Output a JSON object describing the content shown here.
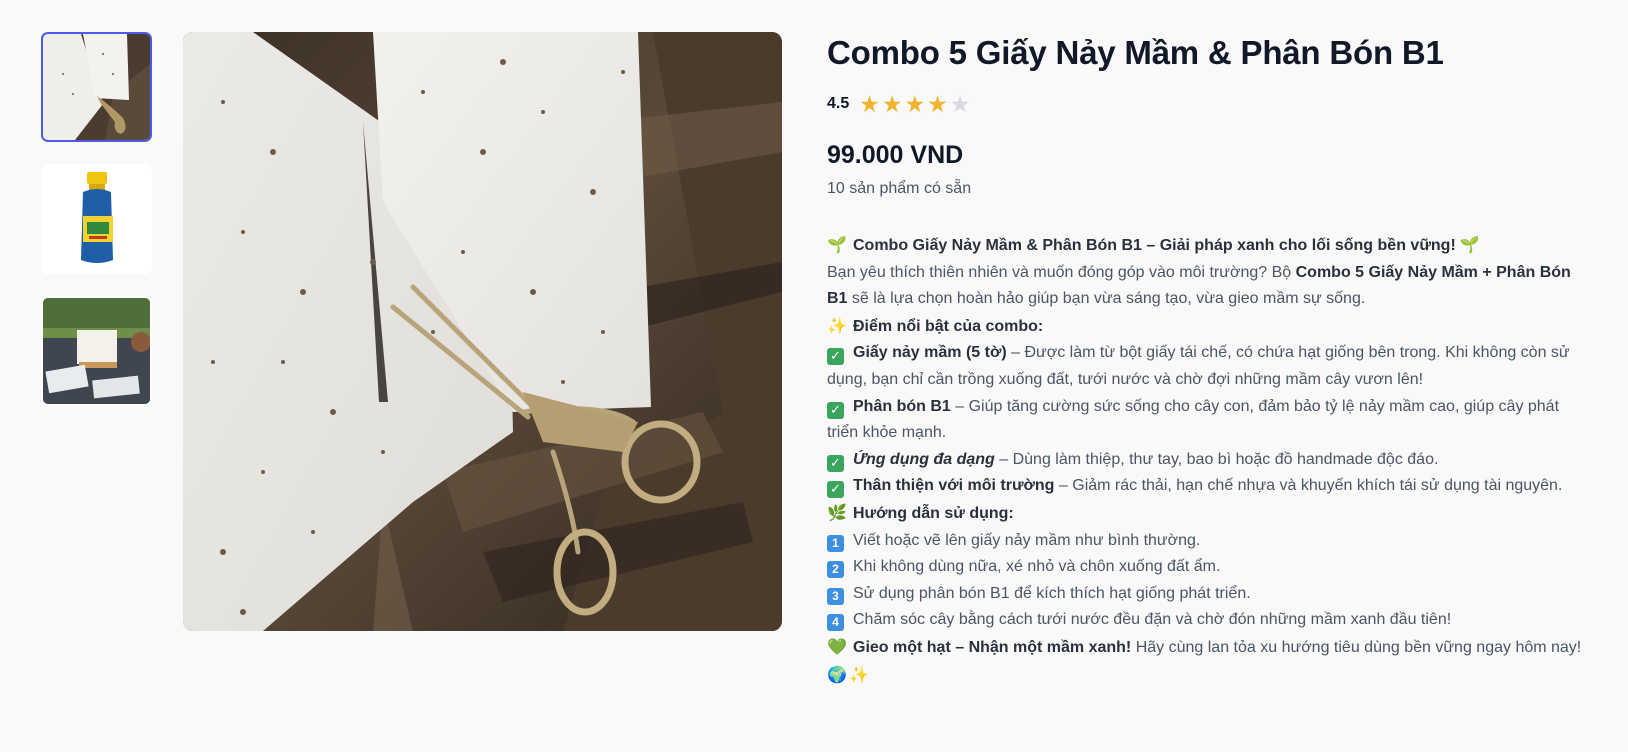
{
  "product": {
    "title": "Combo 5 Giấy Nảy Mầm & Phân Bón B1",
    "rating": {
      "value": "4.5",
      "stars": [
        "★",
        "★",
        "★",
        "★",
        "★"
      ],
      "filled": 4
    },
    "price": "99.000 VND",
    "stock": "10 sản phẩm có sẵn"
  },
  "gallery": {
    "thumbnails": [
      {
        "icon": "seed-paper-scissors-thumbnail",
        "selected": true
      },
      {
        "icon": "fertilizer-bottle-thumbnail",
        "selected": false
      },
      {
        "icon": "garden-table-cards-thumbnail",
        "selected": false
      }
    ],
    "main_image": "seed-paper-with-scissors-photo"
  },
  "description": {
    "headline_icon": "🌱",
    "headline": "Combo Giấy Nảy Mầm & Phân Bón B1 – Giải pháp xanh cho lối sống bền vững!",
    "headline_icon_end": "🌱",
    "intro_pre": "Bạn yêu thích thiên nhiên và muốn đóng góp vào môi trường? Bộ ",
    "intro_bold": "Combo 5 Giấy Nảy Mầm + Phân Bón B1",
    "intro_post": " sẽ là lựa chọn hoàn hảo giúp bạn vừa sáng tạo, vừa gieo mầm sự sống.",
    "features_icon": "✨",
    "features_heading": "Điểm nổi bật của combo:",
    "check_glyph": "✓",
    "f1_bold": "Giấy nảy mầm (5 tờ)",
    "f1_text": " – Được làm từ bột giấy tái chế, có chứa hạt giống bên trong. Khi không còn sử dụng, bạn chỉ cần trồng xuống đất, tưới nước và chờ đợi những mầm cây vươn lên!",
    "f2_bold": "Phân bón B1",
    "f2_text": " – Giúp tăng cường sức sống cho cây con, đảm bảo tỷ lệ nảy mầm cao, giúp cây phát triển khỏe mạnh.",
    "f3_bold": "Ứng dụng đa dạng",
    "f3_text": " – Dùng làm thiệp, thư tay, bao bì hoặc đồ handmade độc đáo.",
    "f4_bold": "Thân thiện với môi trường",
    "f4_text": " – Giảm rác thải, hạn chế nhựa và khuyến khích tái sử dụng tài nguyên.",
    "guide_icon": "🌿",
    "guide_heading": "Hướng dẫn sử dụng:",
    "s1_num": "1",
    "s1": "Viết hoặc vẽ lên giấy nảy mầm như bình thường.",
    "s2_num": "2",
    "s2": "Khi không dùng nữa, xé nhỏ và chôn xuống đất ẩm.",
    "s3_num": "3",
    "s3": "Sử dụng phân bón B1 để kích thích hạt giống phát triển.",
    "s4_num": "4",
    "s4": "Chăm sóc cây bằng cách tưới nước đều đặn và chờ đón những mầm xanh đầu tiên!",
    "closing_icon": "💚",
    "closing_bold": "Gieo một hạt – Nhận một mầm xanh!",
    "closing_text": " Hãy cùng lan tỏa xu hướng tiêu dùng bền vững ngay hôm nay! ",
    "closing_icon_globe": "🌍",
    "closing_icon_end": "✨"
  },
  "colors": {
    "accent_border": "#4f5be6",
    "star_filled": "#f0b431",
    "star_empty": "#d7dbe0",
    "check_badge": "#3aa55c",
    "number_badge": "#3d8fe2"
  }
}
